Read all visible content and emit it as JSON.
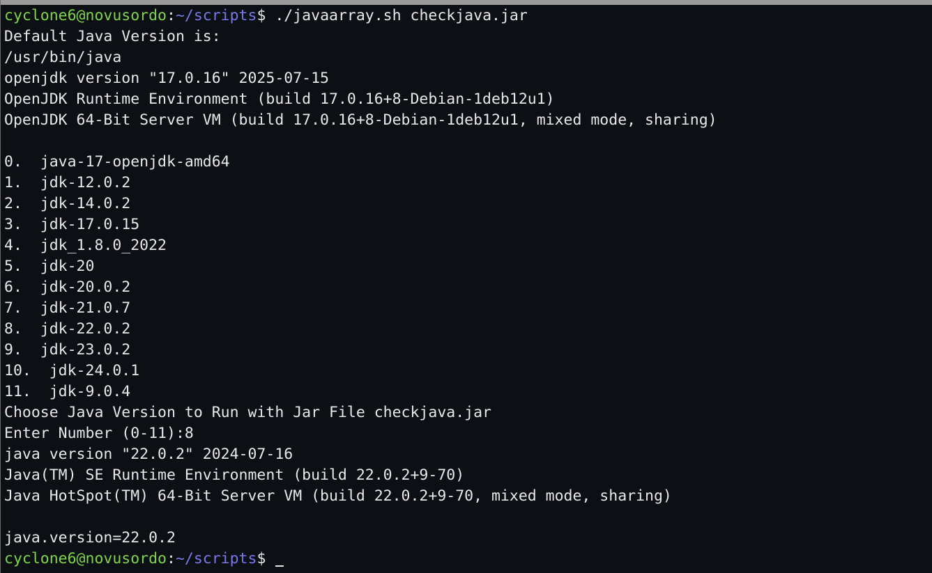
{
  "terminal": {
    "colors": {
      "background": "#0c1014",
      "text": "#e8e8e8",
      "user": "#7fd34d",
      "path": "#7b76ea"
    },
    "prompt": {
      "user_host": "cyclone6@novusordo",
      "separator": ":",
      "path": "~/scripts",
      "symbol": "$"
    },
    "command": " ./javaarray.sh checkjava.jar",
    "output_lines": [
      "Default Java Version is:",
      "/usr/bin/java",
      "openjdk version \"17.0.16\" 2025-07-15",
      "OpenJDK Runtime Environment (build 17.0.16+8-Debian-1deb12u1)",
      "OpenJDK 64-Bit Server VM (build 17.0.16+8-Debian-1deb12u1, mixed mode, sharing)",
      "",
      "0.  java-17-openjdk-amd64",
      "1.  jdk-12.0.2",
      "2.  jdk-14.0.2",
      "3.  jdk-17.0.15",
      "4.  jdk_1.8.0_2022",
      "5.  jdk-20",
      "6.  jdk-20.0.2",
      "7.  jdk-21.0.7",
      "8.  jdk-22.0.2",
      "9.  jdk-23.0.2",
      "10.  jdk-24.0.1",
      "11.  jdk-9.0.4",
      "Choose Java Version to Run with Jar File checkjava.jar",
      "Enter Number (0-11):8",
      "java version \"22.0.2\" 2024-07-16",
      "Java(TM) SE Runtime Environment (build 22.0.2+9-70)",
      "Java HotSpot(TM) 64-Bit Server VM (build 22.0.2+9-70, mixed mode, sharing)",
      "",
      "java.version=22.0.2"
    ]
  }
}
